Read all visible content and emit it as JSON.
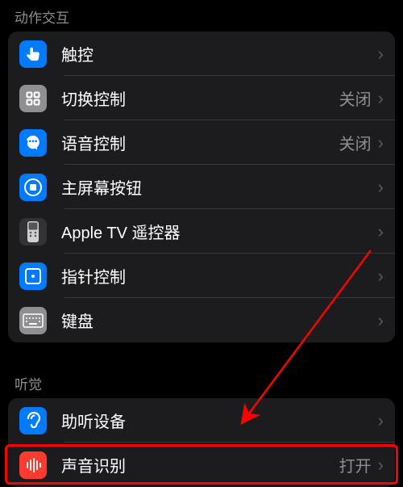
{
  "sections": {
    "interaction": {
      "header": "动作交互",
      "items": [
        {
          "name": "touch",
          "label": "触控",
          "value": "",
          "icon": "touch-icon",
          "color": "blue"
        },
        {
          "name": "switch-control",
          "label": "切换控制",
          "value": "关闭",
          "icon": "grid-icon",
          "color": "gray"
        },
        {
          "name": "voice-control",
          "label": "语音控制",
          "value": "关闭",
          "icon": "voice-icon",
          "color": "blue"
        },
        {
          "name": "home-button",
          "label": "主屏幕按钮",
          "value": "",
          "icon": "home-icon",
          "color": "blue"
        },
        {
          "name": "apple-tv-remote",
          "label": "Apple TV 遥控器",
          "value": "",
          "icon": "remote-icon",
          "color": "dark"
        },
        {
          "name": "pointer-control",
          "label": "指针控制",
          "value": "",
          "icon": "pointer-icon",
          "color": "blue"
        },
        {
          "name": "keyboard",
          "label": "键盘",
          "value": "",
          "icon": "keyboard-icon",
          "color": "gray"
        }
      ]
    },
    "hearing": {
      "header": "听觉",
      "items": [
        {
          "name": "hearing-devices",
          "label": "助听设备",
          "value": "",
          "icon": "ear-icon",
          "color": "blue"
        },
        {
          "name": "sound-recognition",
          "label": "声音识别",
          "value": "打开",
          "icon": "sound-icon",
          "color": "red"
        }
      ]
    }
  }
}
